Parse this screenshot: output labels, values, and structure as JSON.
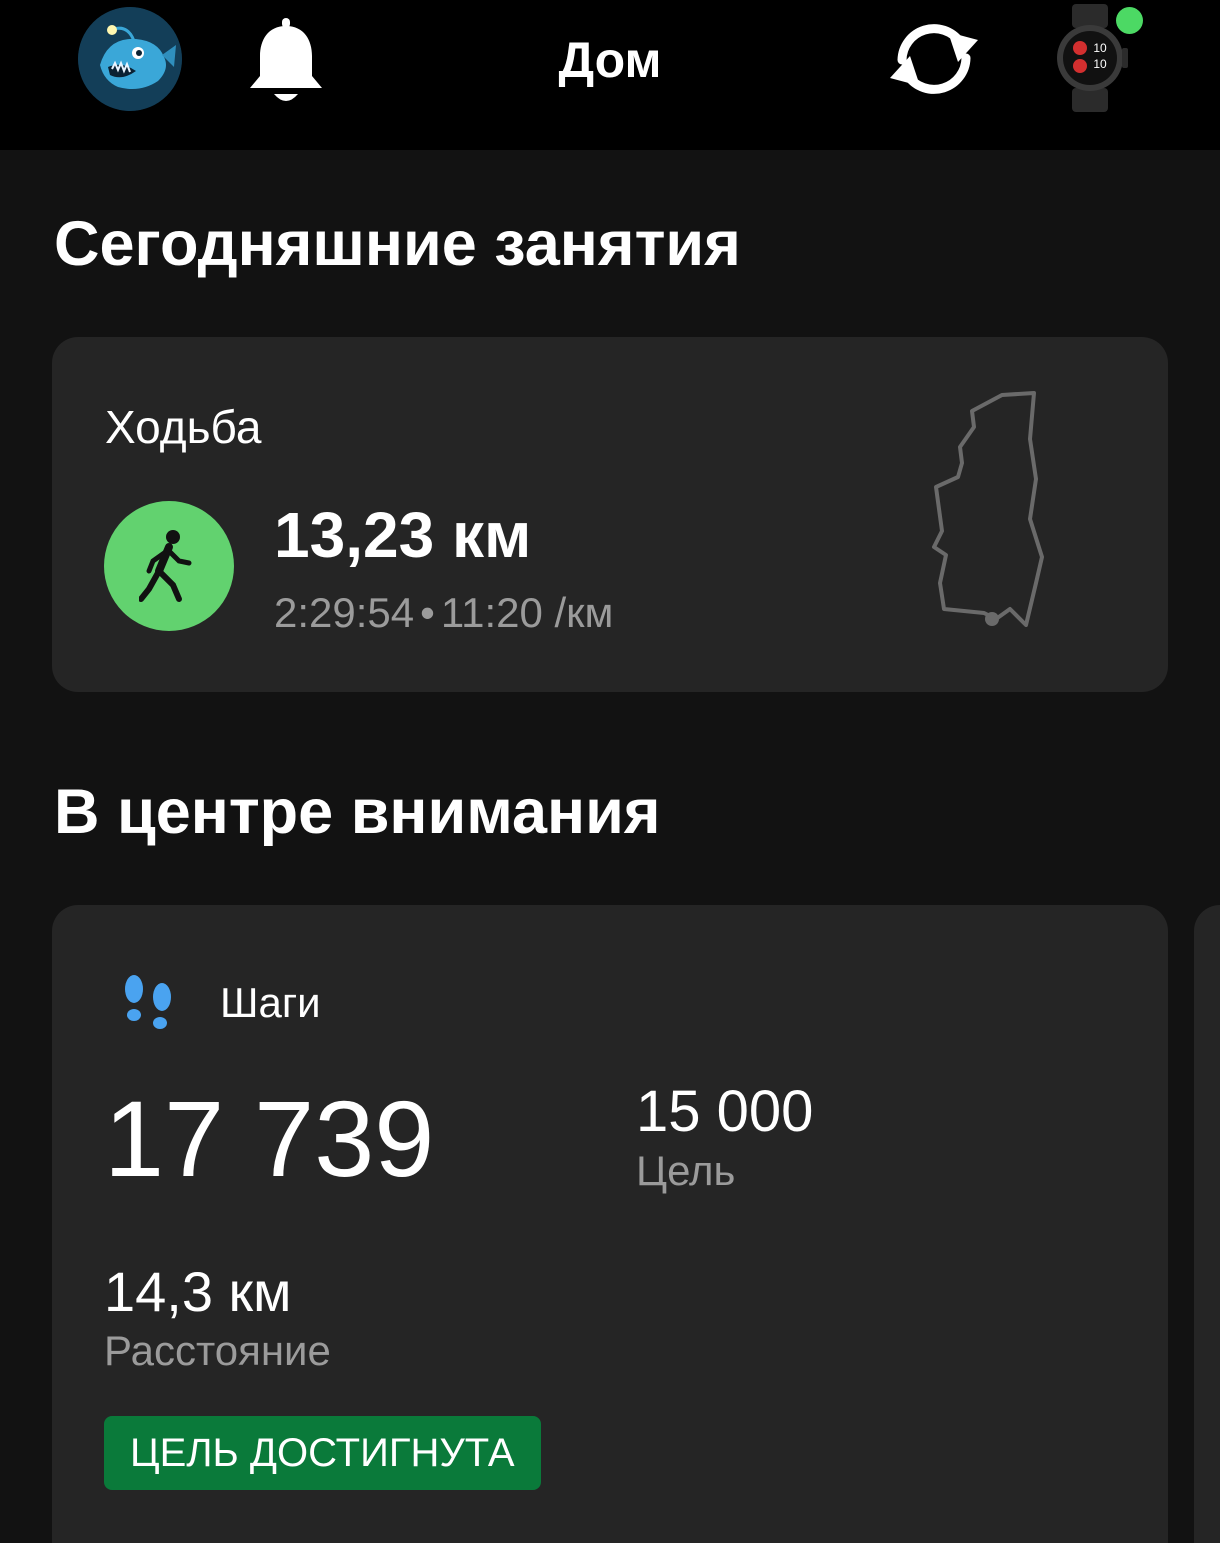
{
  "header": {
    "title": "Дом",
    "avatar_icon": "anglerfish-avatar-icon",
    "notifications_icon": "bell-icon",
    "sync_icon": "sync-icon",
    "device_icon": "smartwatch-icon",
    "device_status_color": "#4cd964"
  },
  "today": {
    "section_title": "Сегодняшние занятия",
    "activity": {
      "name": "Ходьба",
      "icon": "walking-person-icon",
      "icon_color": "#62d26f",
      "distance": "13,23 км",
      "duration": "2:29:54",
      "separator": "•",
      "pace": "11:20 /км"
    }
  },
  "highlights": {
    "section_title": "В центре внимания",
    "steps_card": {
      "icon": "footprints-icon",
      "label": "Шаги",
      "value": "17 739",
      "goal_value": "15 000",
      "goal_label": "Цель",
      "distance_value": "14,3 км",
      "distance_label": "Расстояние",
      "badge": "ЦЕЛЬ ДОСТИГНУТА",
      "badge_color": "#0a7a3a"
    }
  }
}
